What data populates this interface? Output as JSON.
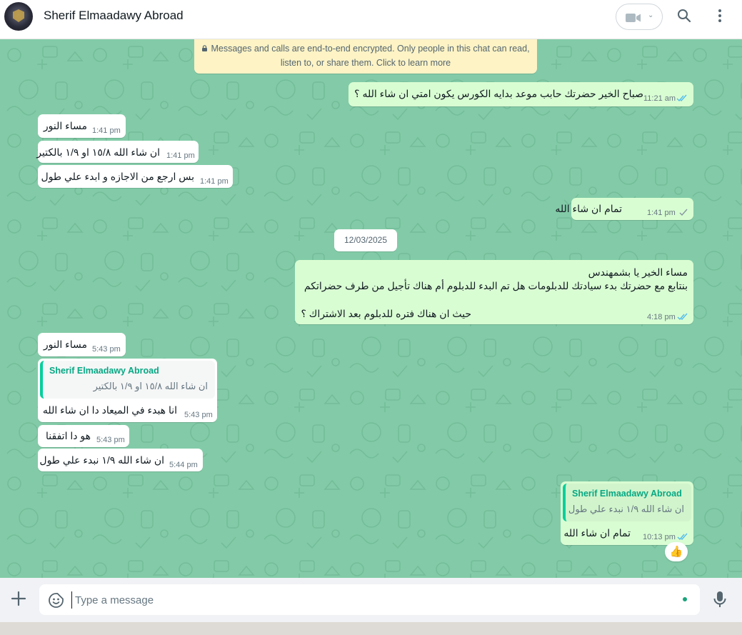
{
  "header": {
    "contact_name": "Sherif Elmaadawy Abroad"
  },
  "banner": {
    "line1": "Messages and calls are end-to-end encrypted. Only people in this chat can read,",
    "line2": "listen to, or share them. Click to learn more"
  },
  "date_separator": "12/03/2025",
  "messages": [
    {
      "text": "صباح الخير حضرتك حابب موعد بدايه الكورس يكون امتي ان شاء الله ؟",
      "time": "11:21 am",
      "status": "read"
    },
    {
      "text": "مساء النور",
      "time": "1:41 pm"
    },
    {
      "text": "ان شاء الله ١٥/٨ او ١/٩ بالكتير",
      "time": "1:41 pm"
    },
    {
      "text": "بس ارجع من الاجازه و ابدء علي طول",
      "time": "1:41 pm"
    },
    {
      "text": "تمام ان شاء الله",
      "time": "1:41 pm",
      "status": "delivered"
    },
    {
      "lines": [
        "مساء الخير يا بشمهندس",
        "بنتابع مع حضرتك بدء سيادتك للدبلومات هل تم البدء للدبلوم أم هناك تأجيل من طرف حضراتكم",
        "حيث ان هناك فتره للدبلوم بعد الاشتراك ؟"
      ],
      "time": "4:18 pm",
      "status": "read"
    },
    {
      "text": "مساء النور",
      "time": "5:43 pm"
    },
    {
      "quote_author": "Sherif Elmaadawy Abroad",
      "quote_text": "ان شاء الله ١٥/٨ او ١/٩ بالكتير",
      "text": "انا هبدء في الميعاد دا ان شاء الله",
      "time": "5:43 pm"
    },
    {
      "text": "هو دا اتفقنا",
      "time": "5:43 pm"
    },
    {
      "text": "ان شاء الله ١/٩ نبدء علي طول",
      "time": "5:44 pm"
    },
    {
      "quote_author": "Sherif Elmaadawy Abroad",
      "quote_text": "ان شاء الله ١/٩ نبدء علي طول",
      "text": "تمام ان شاء الله",
      "time": "10:13 pm",
      "status": "read",
      "reaction": "👍"
    }
  ],
  "composer": {
    "placeholder": "Type a message"
  },
  "icons": {
    "avatar": "avatar",
    "video": "video-call-icon",
    "search": "search-icon",
    "menu": "menu-icon",
    "attach": "plus-icon",
    "sticker": "sticker-icon",
    "mic": "mic-icon",
    "lock": "lock-icon"
  },
  "colors": {
    "chat_bg": "#83cba8",
    "outgoing": "#d9fdd3",
    "incoming": "#ffffff",
    "read_ticks": "#53bdeb",
    "banner": "#fdf3c5",
    "accent": "#06a884"
  }
}
